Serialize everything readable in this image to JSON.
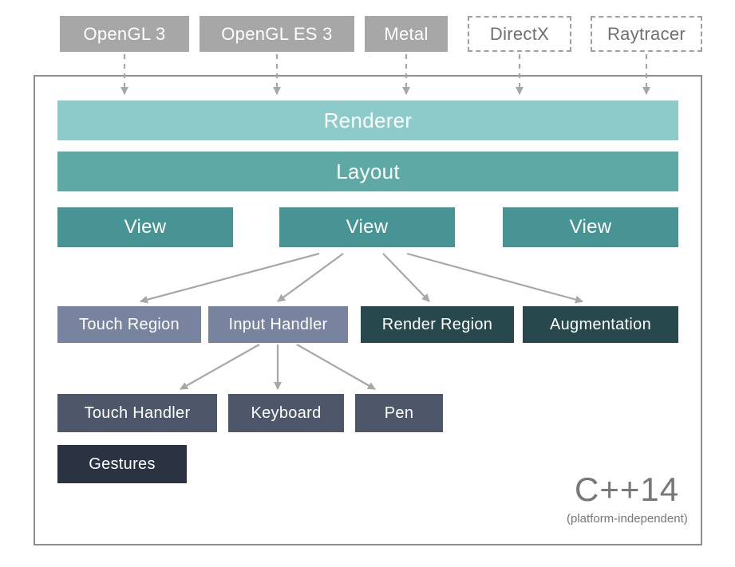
{
  "colors": {
    "grayBox": "#a7a7a7",
    "grayText": "#707070",
    "containerBorder": "#8d8d8d",
    "dashedBorder": "#919191",
    "arrow": "#a7a7a7",
    "tealLight": "#8ccbc9",
    "tealMid": "#5ea9a5",
    "tealDarker": "#489495",
    "blueGray": "#78849f",
    "darkTeal": "#27494d",
    "slate": "#4d5769",
    "navy": "#2b3343"
  },
  "backends": [
    {
      "id": "opengl3",
      "label": "OpenGL 3",
      "solid": true
    },
    {
      "id": "opengles3",
      "label": "OpenGL ES 3",
      "solid": true
    },
    {
      "id": "metal",
      "label": "Metal",
      "solid": true
    },
    {
      "id": "directx",
      "label": "DirectX",
      "solid": false
    },
    {
      "id": "raytracer",
      "label": "Raytracer",
      "solid": false
    }
  ],
  "layers": {
    "renderer": "Renderer",
    "layout": "Layout",
    "views": [
      "View",
      "View",
      "View"
    ]
  },
  "viewChildren": [
    {
      "id": "touch-region",
      "label": "Touch Region"
    },
    {
      "id": "input-handler",
      "label": "Input Handler"
    },
    {
      "id": "render-region",
      "label": "Render Region"
    },
    {
      "id": "augmentation",
      "label": "Augmentation"
    }
  ],
  "inputHandlers": [
    {
      "id": "touch-handler",
      "label": "Touch Handler"
    },
    {
      "id": "keyboard",
      "label": "Keyboard"
    },
    {
      "id": "pen",
      "label": "Pen"
    }
  ],
  "gestures": "Gestures",
  "language": {
    "name": "C++14",
    "note": "(platform-independent)"
  }
}
